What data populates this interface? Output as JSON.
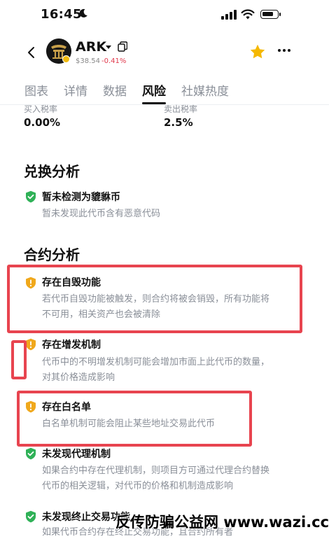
{
  "status_bar": {
    "time": "16:45",
    "icons": [
      "moon-icon",
      "signal-icon",
      "wifi-icon",
      "battery-icon"
    ]
  },
  "header": {
    "ticker": "ARK",
    "price": "$38.54",
    "change": "-0.41%",
    "icons": [
      "back-arrow-icon",
      "coin-logo",
      "chevron-down-icon",
      "copy-icon",
      "star-icon",
      "more-icon"
    ],
    "colors": {
      "star": "#f5b800",
      "negative_change": "#e0384b"
    }
  },
  "tabs": [
    {
      "label": "图表",
      "active": false
    },
    {
      "label": "详情",
      "active": false
    },
    {
      "label": "数据",
      "active": false
    },
    {
      "label": "风险",
      "active": true
    },
    {
      "label": "社媒热度",
      "active": false
    }
  ],
  "taxes": {
    "buy_label": "买入税率",
    "buy_value": "0.00%",
    "sell_label": "卖出税率",
    "sell_value": "2.5%"
  },
  "swap_section": {
    "title": "兑换分析",
    "items": [
      {
        "status": "safe",
        "title": "暂未检测为貔貅币",
        "desc": "暂未发现此代币含有恶意代码"
      }
    ]
  },
  "contract_section": {
    "title": "合约分析",
    "items": [
      {
        "status": "warning",
        "title": "存在自毁功能",
        "desc_lines": [
          "若代币自毁功能被触发，则合约将被会销毁，所有功能将",
          "不可用，相关资产也会被清除"
        ]
      },
      {
        "status": "warning",
        "title": "存在增发机制",
        "desc_lines": [
          "代币中的不明增发机制可能会增加市面上此代币的数量，",
          "对其价格造成影响"
        ]
      },
      {
        "status": "warning",
        "title": "存在白名单",
        "desc_lines": [
          "白名单机制可能会阻止某些地址交易此代币"
        ]
      },
      {
        "status": "safe",
        "title": "未发现代理机制",
        "desc_lines": [
          "如果合约中存在代理机制，则项目方可通过代理合约替换",
          "代币的相关逻辑，对代币的价格和机制造成影响"
        ]
      },
      {
        "status": "safe",
        "title": "未发现终止交易功能",
        "desc_lines": [
          "如果代币合约存在终止交易功能，且合约所有者"
        ]
      }
    ]
  },
  "status_colors": {
    "safe": "#2fb157",
    "warning": "#f0a81c",
    "highlight": "#e8444f"
  },
  "watermark": "反传防骗公益网 www.wazi.cc"
}
